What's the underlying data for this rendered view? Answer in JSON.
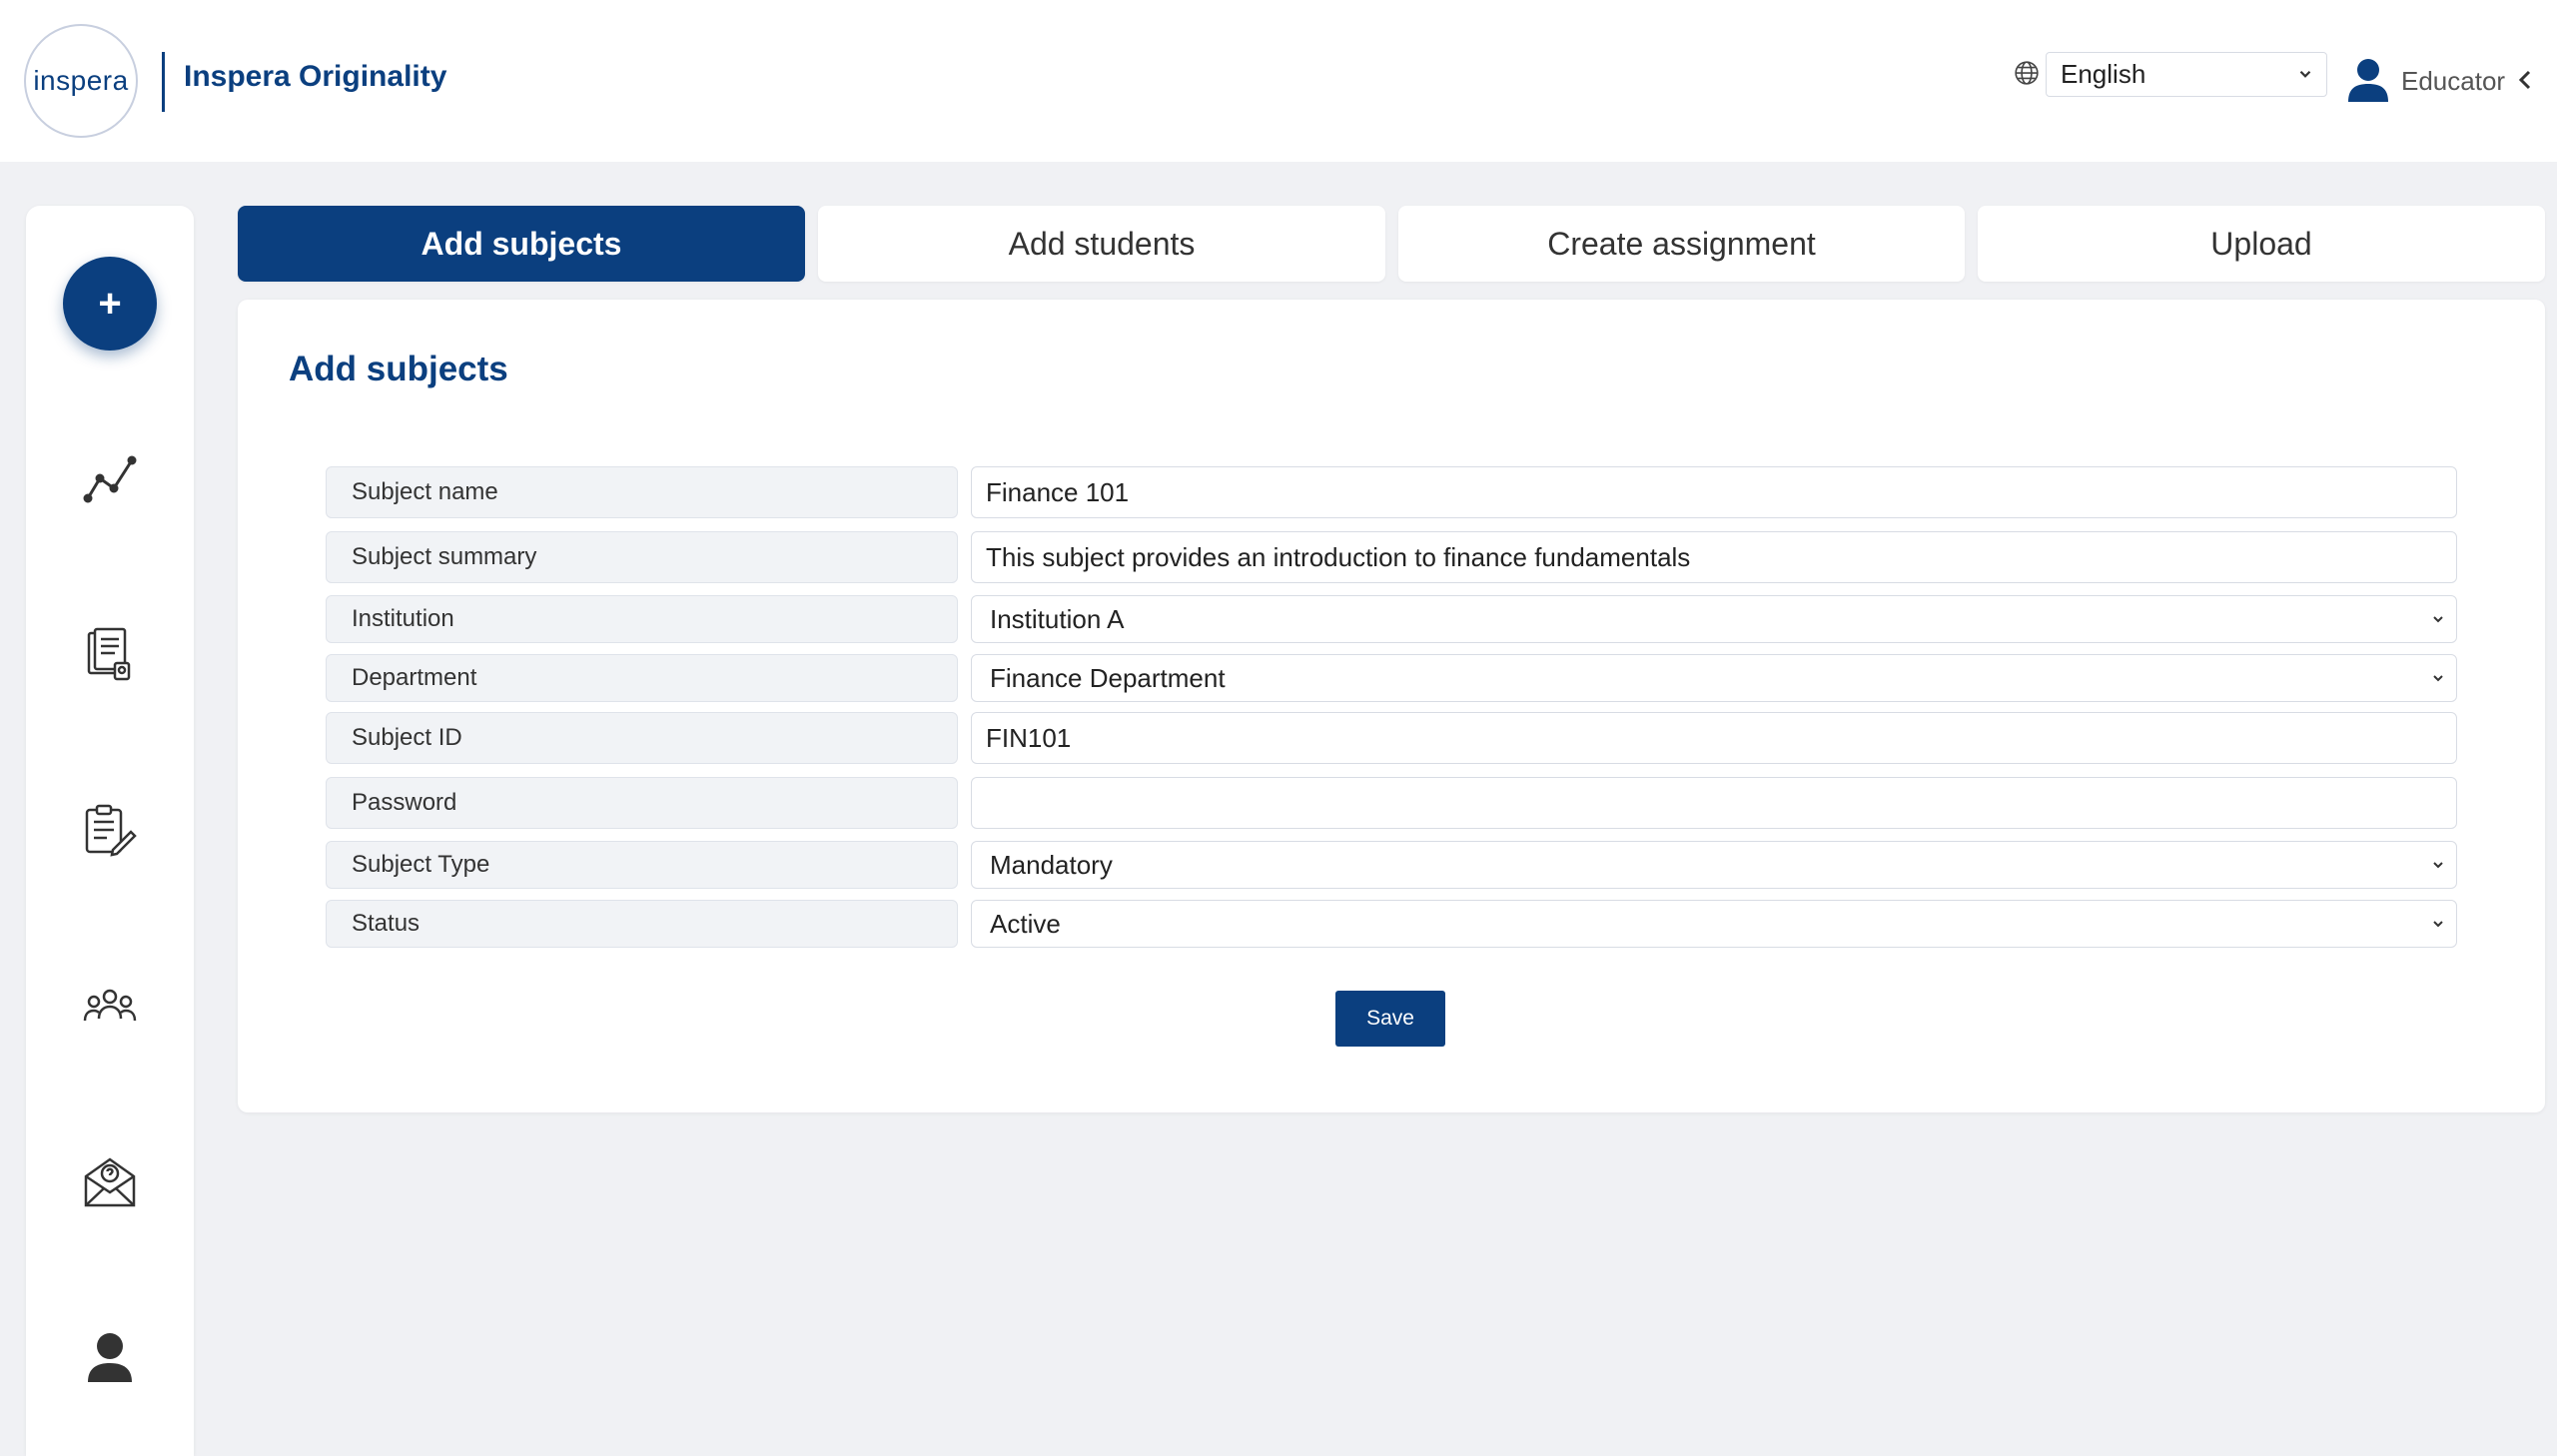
{
  "header": {
    "logo_text": "inspera",
    "brand_name": "Inspera Originality",
    "language": "English",
    "user_role": "Educator"
  },
  "sidebar": {
    "add_button_label": "+",
    "items": [
      {
        "icon": "analytics-chart-icon"
      },
      {
        "icon": "documents-icon"
      },
      {
        "icon": "assignment-edit-icon"
      },
      {
        "icon": "users-group-icon"
      },
      {
        "icon": "help-mail-icon"
      },
      {
        "icon": "profile-icon"
      }
    ]
  },
  "tabs": [
    {
      "label": "Add subjects",
      "active": true
    },
    {
      "label": "Add students",
      "active": false
    },
    {
      "label": "Create assignment",
      "active": false
    },
    {
      "label": "Upload",
      "active": false
    }
  ],
  "form": {
    "title": "Add subjects",
    "fields": [
      {
        "label": "Subject name",
        "value": "Finance 101",
        "type": "text"
      },
      {
        "label": "Subject summary",
        "value": "This subject provides an introduction to finance fundamentals",
        "type": "text"
      },
      {
        "label": "Institution",
        "value": "Institution A",
        "type": "select"
      },
      {
        "label": "Department",
        "value": "Finance Department",
        "type": "select"
      },
      {
        "label": "Subject ID",
        "value": "FIN101",
        "type": "text"
      },
      {
        "label": "Password",
        "value": "",
        "type": "password"
      },
      {
        "label": "Subject Type",
        "value": "Mandatory",
        "type": "select"
      },
      {
        "label": "Status",
        "value": "Active",
        "type": "select"
      }
    ],
    "save_label": "Save"
  },
  "colors": {
    "brand": "#0b3f7f",
    "background": "#f0f1f4",
    "label_bg": "#f1f3f6"
  }
}
